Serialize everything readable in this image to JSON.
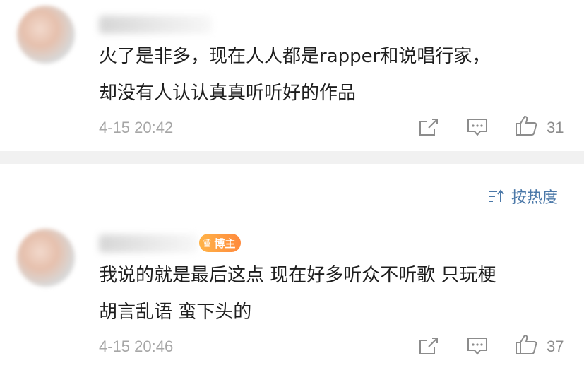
{
  "comments": [
    {
      "text_lines": [
        "火了是非多，现在人人都是rapper和说唱行家，",
        "却没有人认认真真听听好的作品"
      ],
      "time": "4-15 20:42",
      "likes": "31"
    },
    {
      "badge": "博主",
      "text_lines": [
        "我说的就是最后这点 现在好多听众不听歌 只玩梗",
        "胡言乱语 蛮下头的"
      ],
      "time": "4-15 20:46",
      "likes": "37"
    }
  ],
  "sort_label": "按热度",
  "icons": [
    "share-icon",
    "reply-icon",
    "like-icon",
    "sort-icon",
    "crown-icon"
  ],
  "colors": {
    "accent": "#4b78a8",
    "badge": "#ff9a3d",
    "meta": "#a6a6a6",
    "divider": "#f1f1f1"
  }
}
